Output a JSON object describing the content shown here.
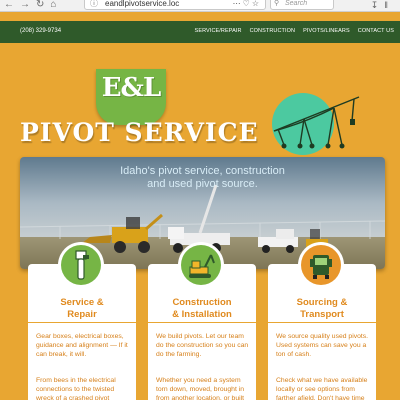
{
  "browser": {
    "url": "eandlpivotservice.loc",
    "search_placeholder": "Search",
    "nav_icons": [
      "back-icon",
      "forward-icon",
      "reload-icon",
      "home-icon"
    ]
  },
  "topbar": {
    "phone": "(208) 329-9734",
    "menu": [
      "SERVICE/REPAIR",
      "CONSTRUCTION",
      "PIVOTS/LINEARS",
      "CONTACT US"
    ]
  },
  "hero": {
    "logo": "E&L",
    "brand": "PIVOT SERVICE",
    "tagline_line1": "Idaho's pivot service, construction",
    "tagline_line2": "and used pivot source."
  },
  "cards": [
    {
      "title_line1": "Service &",
      "title_line2": "Repair",
      "icon": "pipe-wrench-icon",
      "p1": "Gear boxes, electrical boxes, guidance and alignment — If it can break, it will.",
      "p2": "From bees in the electrical connections to the twisted wreck of a crashed pivot"
    },
    {
      "title_line1": "Construction",
      "title_line2": "& Installation",
      "icon": "excavator-icon",
      "p1": "We build pivots. Let our team do the construction so you can do the farming.",
      "p2": "Whether you need a system torn down, moved, brought in from another location, or built and installed from"
    },
    {
      "title_line1": "Sourcing &",
      "title_line2": "Transport",
      "icon": "semi-truck-icon",
      "p1": "We source quality used pivots. Used systems can save you a ton of cash.",
      "p2": "Check what we have available locally or see options from farther afield. Don't have time to drive to"
    }
  ],
  "colors": {
    "accent_orange": "#e8a632",
    "dark_green": "#2f5a2a",
    "logo_green": "#76b545",
    "card_text": "#d67f18",
    "card_title": "#e08a1e"
  }
}
